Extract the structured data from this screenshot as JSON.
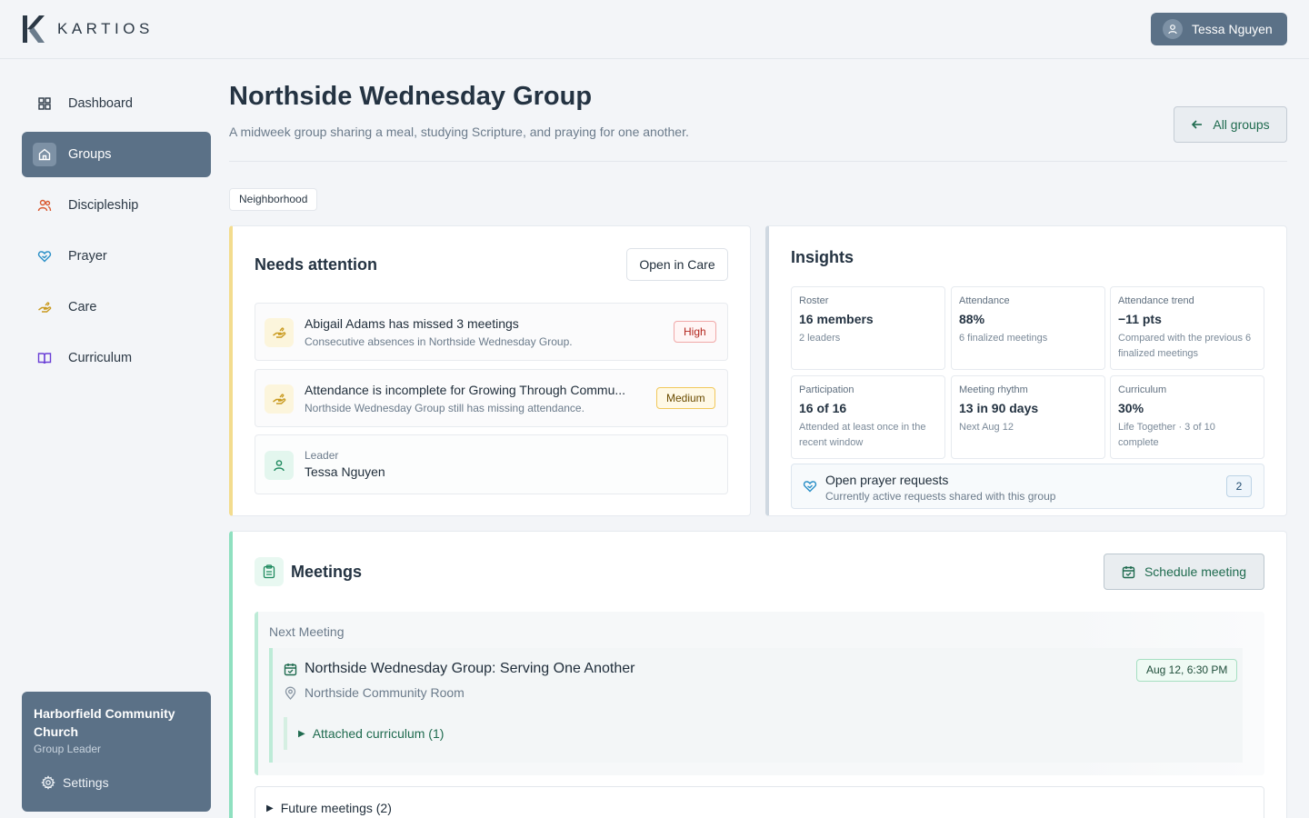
{
  "brand": {
    "name": "KARTIOS"
  },
  "user": {
    "name": "Tessa Nguyen"
  },
  "sidebar": {
    "items": [
      {
        "label": "Dashboard",
        "icon": "dashboard-icon"
      },
      {
        "label": "Groups",
        "icon": "home-icon",
        "active": true
      },
      {
        "label": "Discipleship",
        "icon": "people-icon"
      },
      {
        "label": "Prayer",
        "icon": "heart-hands-icon"
      },
      {
        "label": "Care",
        "icon": "care-hand-icon"
      },
      {
        "label": "Curriculum",
        "icon": "book-icon"
      }
    ],
    "org": {
      "name": "Harborfield Community Church",
      "role": "Group Leader",
      "settings_label": "Settings"
    }
  },
  "header": {
    "title": "Northside Wednesday Group",
    "subtitle": "A midweek group sharing a meal, studying Scripture, and praying for one another.",
    "back_label": "All groups",
    "tag": "Neighborhood"
  },
  "needs": {
    "title": "Needs attention",
    "action_label": "Open in Care",
    "alerts": [
      {
        "title": "Abigail Adams has missed 3 meetings",
        "description": "Consecutive absences in Northside Wednesday Group.",
        "severity": "High"
      },
      {
        "title": "Attendance is incomplete for Growing Through Commu...",
        "description": "Northside Wednesday Group still has missing attendance.",
        "severity": "Medium"
      }
    ],
    "leader": {
      "label": "Leader",
      "name": "Tessa Nguyen"
    }
  },
  "insights": {
    "title": "Insights",
    "stats": [
      {
        "label": "Roster",
        "value": "16 members",
        "sub": "2 leaders"
      },
      {
        "label": "Attendance",
        "value": "88%",
        "sub": "6 finalized meetings"
      },
      {
        "label": "Attendance trend",
        "value": "−11 pts",
        "sub": "Compared with the previous 6 finalized meetings"
      },
      {
        "label": "Participation",
        "value": "16 of 16",
        "sub": "Attended at least once in the recent window"
      },
      {
        "label": "Meeting rhythm",
        "value": "13 in 90 days",
        "sub": "Next Aug 12"
      },
      {
        "label": "Curriculum",
        "value": "30%",
        "sub": "Life Together · 3 of 10 complete"
      }
    ],
    "prayer": {
      "title": "Open prayer requests",
      "subtitle": "Currently active requests shared with this group",
      "count": "2"
    }
  },
  "meetings": {
    "title": "Meetings",
    "schedule_label": "Schedule meeting",
    "next_label": "Next Meeting",
    "next": {
      "title": "Northside Wednesday Group: Serving One Another",
      "location": "Northside Community Room",
      "date": "Aug 12, 6:30 PM",
      "curriculum_label": "Attached curriculum (1)"
    },
    "future_label": "Future meetings (2)"
  },
  "colors": {
    "accent_green": "#1f6b4f",
    "slate": "#5b7187",
    "high": "#b3261e",
    "medium": "#f1c85b"
  }
}
